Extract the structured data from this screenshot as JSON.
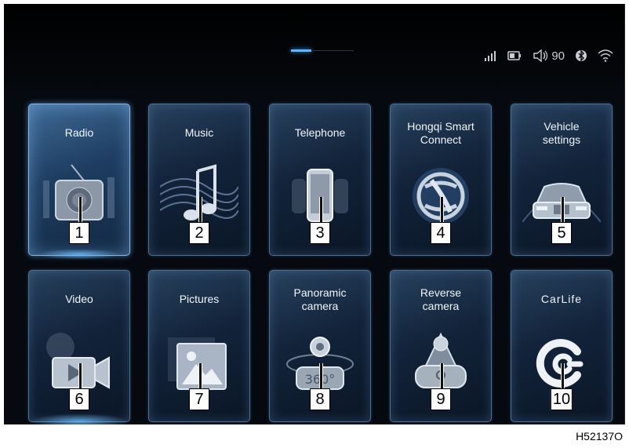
{
  "status": {
    "volume": "90",
    "icons": [
      "signal-icon",
      "battery-icon",
      "speaker-icon",
      "bluetooth-icon",
      "wifi-icon"
    ]
  },
  "tiles": [
    {
      "label": "Radio",
      "number": "1",
      "icon": "radio-icon",
      "selected": true
    },
    {
      "label": "Music",
      "number": "2",
      "icon": "music-note-icon"
    },
    {
      "label": "Telephone",
      "number": "3",
      "icon": "phone-icon"
    },
    {
      "label": "Hongqi Smart\nConnect",
      "number": "4",
      "icon": "hongqi-logo-icon"
    },
    {
      "label": "Vehicle\nsettings",
      "number": "5",
      "icon": "car-icon"
    },
    {
      "label": "Video",
      "number": "6",
      "icon": "video-camera-icon"
    },
    {
      "label": "Pictures",
      "number": "7",
      "icon": "picture-icon"
    },
    {
      "label": "Panoramic\ncamera",
      "number": "8",
      "icon": "panoramic-camera-icon",
      "badge": "360°"
    },
    {
      "label": "Reverse\ncamera",
      "number": "9",
      "icon": "reverse-camera-icon"
    },
    {
      "label": "CarLife",
      "number": "10",
      "icon": "carlife-icon"
    }
  ],
  "figure_code": "H52137O",
  "colors": {
    "accent": "#5fb7ff",
    "background": "#06090f",
    "tile_border": "#4d6f93"
  }
}
